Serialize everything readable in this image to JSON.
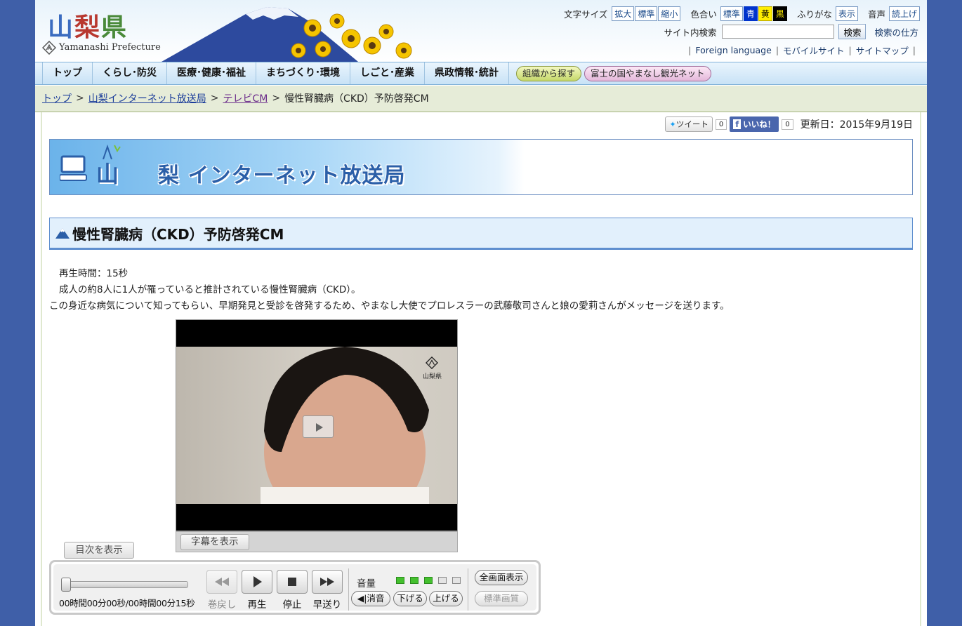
{
  "header": {
    "logo_kanji": [
      "山",
      "梨",
      "県"
    ],
    "logo_en": "Yamanashi Prefecture",
    "font_size_label": "文字サイズ",
    "font_size_options": [
      "拡大",
      "標準",
      "縮小"
    ],
    "color_label": "色合い",
    "color_options": [
      "標準",
      "青",
      "黄",
      "黒"
    ],
    "furigana_label": "ふりがな",
    "furigana_btn": "表示",
    "voice_label": "音声",
    "voice_btn": "読上げ",
    "search_label": "サイト内検索",
    "search_value": "",
    "search_btn": "検索",
    "search_help": "検索の仕方",
    "links": [
      "Foreign language",
      "モバイルサイト",
      "サイトマップ"
    ]
  },
  "nav": {
    "items": [
      "トップ",
      "くらし･防災",
      "医療･健康･福祉",
      "まちづくり･環境",
      "しごと･産業",
      "県政情報･統計"
    ],
    "org_btn": "組織から探す",
    "tour_btn": "富士の国やまなし観光ネット"
  },
  "breadcrumb": {
    "links": [
      "トップ",
      "山梨インターネット放送局",
      "テレビCM"
    ],
    "current": "慢性腎臓病（CKD）予防啓発CM",
    "sep": ">"
  },
  "social": {
    "tweet": "ツイート",
    "tweet_count": "0",
    "like": "いいね！",
    "like_count": "0",
    "updated": "更新日：2015年9月19日"
  },
  "banner": {
    "yama": "山",
    "title": "梨 インターネット放送局"
  },
  "page": {
    "heading": "慢性腎臓病（CKD）予防啓発CM",
    "p1": "再生時間：15秒",
    "p2": "成人の約8人に1人が罹っていると推計されている慢性腎臓病（CKD）。",
    "p3": "この身近な病気について知ってもらい、早期発見と受診を啓発するため、やまなし大使でプロレスラーの武藤敬司さんと娘の愛莉さんがメッセージを送ります。"
  },
  "video": {
    "seal_text": "山梨県",
    "subtitle_btn": "字幕を表示",
    "toc_btn": "目次を表示"
  },
  "player": {
    "timecode": "00時間00分00秒/00時間00分15秒",
    "progress_fraction": 0,
    "rewind": "巻戻し",
    "play": "再生",
    "stop": "停止",
    "forward": "早送り",
    "volume_label": "音量",
    "volume_level": 3,
    "volume_max": 5,
    "mute": "消音",
    "vol_down": "下げる",
    "vol_up": "上げる",
    "fullscreen": "全画面表示",
    "quality": "標準画質"
  },
  "colors": {
    "body_bg": "#3f5fa8",
    "volume_on": "#44c02e",
    "heading_border": "#5f8fcf"
  }
}
